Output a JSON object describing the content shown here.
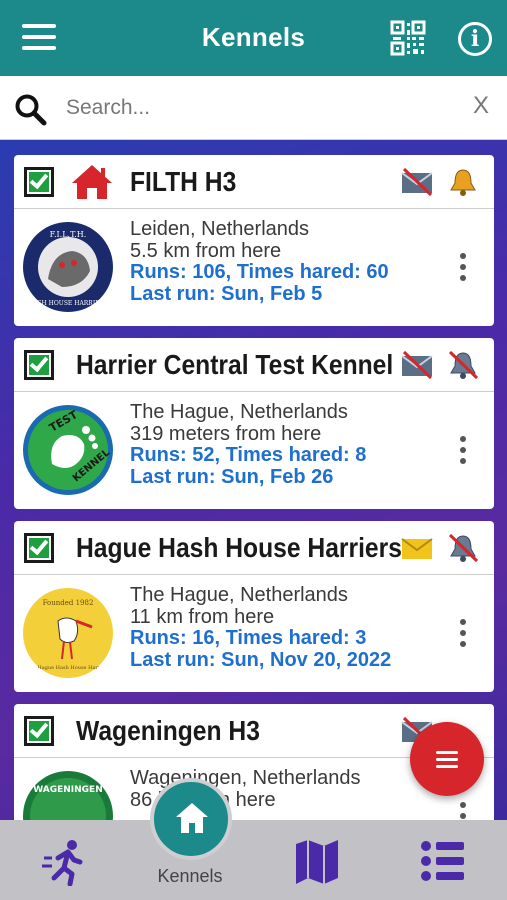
{
  "header": {
    "title": "Kennels",
    "menu_icon": "hamburger-menu-icon",
    "qr_icon": "qr-code-icon",
    "info_icon": "info-icon",
    "info_glyph": "i"
  },
  "search": {
    "placeholder": "Search...",
    "value": "",
    "clear_label": "X"
  },
  "kennels": [
    {
      "name": "FILTH H3",
      "checked": true,
      "home": true,
      "mail_status": "email-disabled-icon",
      "notify_status": "bell-enabled-icon",
      "logo": {
        "name": "filth-h3-logo",
        "top_text": "F.I.L.T.H.",
        "bottom_text": "HASH HOUSE HARRIERS"
      },
      "location": "Leiden, Netherlands",
      "distance": "5.5 km from here",
      "stats": "Runs: 106, Times hared: 60",
      "last_run": "Last run: Sun, Feb 5"
    },
    {
      "name": "Harrier Central Test Kennel",
      "checked": true,
      "home": false,
      "mail_status": "email-disabled-icon",
      "notify_status": "bell-disabled-icon",
      "logo": {
        "name": "test-kennel-logo",
        "top_text": "TEST",
        "bottom_text": "KENNEL"
      },
      "location": "The Hague, Netherlands",
      "distance": "319 meters from here",
      "stats": "Runs: 52, Times hared: 8",
      "last_run": "Last run: Sun, Feb 26"
    },
    {
      "name": "Hague Hash House Harriers",
      "checked": true,
      "home": false,
      "mail_status": "email-enabled-icon",
      "notify_status": "bell-disabled-icon",
      "logo": {
        "name": "hague-h3-logo",
        "top_text": "Founded 1982",
        "bottom_text": "The Hague Hash House Harriers"
      },
      "location": "The Hague, Netherlands",
      "distance": "11 km from here",
      "stats": "Runs: 16, Times hared: 3",
      "last_run": "Last run: Sun, Nov 20, 2022"
    },
    {
      "name": "Wageningen H3",
      "checked": true,
      "home": false,
      "mail_status": "email-disabled-icon",
      "notify_status": "bell-disabled-icon",
      "logo": {
        "name": "wageningen-h3-logo",
        "top_text": "WAGENINGEN",
        "bottom_text": ""
      },
      "location": "Wageningen, Netherlands",
      "distance": "86 km from here",
      "stats": "",
      "last_run": ""
    }
  ],
  "fab": {
    "icon": "list-menu-icon"
  },
  "bottom_nav": {
    "items": [
      {
        "name": "runs",
        "icon": "running-person-icon"
      },
      {
        "name": "kennels",
        "icon": "home-icon",
        "label": "Kennels",
        "active": true
      },
      {
        "name": "map",
        "icon": "map-icon"
      },
      {
        "name": "list",
        "icon": "list-icon"
      }
    ]
  },
  "colors": {
    "primary": "#1c8a8a",
    "accent": "#d6262b",
    "link": "#1e6fcf",
    "nav_icon": "#4a2aa8",
    "checkbox": "#1fa040"
  }
}
